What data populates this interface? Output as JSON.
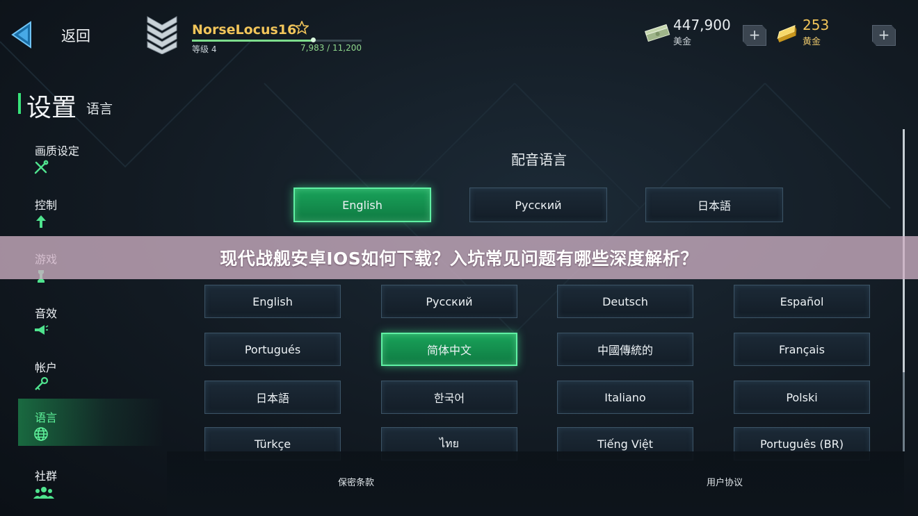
{
  "topbar": {
    "back_label": "返回",
    "player_name": "NorseLocus16",
    "level_label": "等级 4",
    "xp_text": "7,983 / 11,200",
    "xp_progress": 0.713,
    "cash": {
      "amount": "447,900",
      "label": "美金"
    },
    "gold": {
      "amount": "253",
      "label": "黄金"
    },
    "colors": {
      "gold_text": "#f2c55a",
      "xp_green": "#7ddc8c"
    }
  },
  "header": {
    "title": "设置",
    "subtitle": "语言"
  },
  "sidebar": {
    "items": [
      {
        "label": "画质设定",
        "icon": "tools-icon"
      },
      {
        "label": "控制",
        "icon": "arrow-up-icon"
      },
      {
        "label": "游戏",
        "icon": "chess-icon"
      },
      {
        "label": "音效",
        "icon": "megaphone-icon"
      },
      {
        "label": "帐户",
        "icon": "key-icon"
      },
      {
        "label": "语言",
        "icon": "globe-icon",
        "active": true
      },
      {
        "label": "社群",
        "icon": "people-icon"
      }
    ]
  },
  "voice": {
    "title": "配音语言",
    "options": [
      "English",
      "Русский",
      "日本語"
    ],
    "selected": "English"
  },
  "text_lang": {
    "options": [
      "English",
      "Русский",
      "Deutsch",
      "Español",
      "Portugués",
      "简体中文",
      "中國傳統的",
      "Français",
      "日本語",
      "한국어",
      "Italiano",
      "Polski",
      "Türkçe",
      "ไทย",
      "Tiếng Việt",
      "Português (BR)"
    ],
    "selected": "简体中文"
  },
  "footer": {
    "privacy": "保密条款",
    "terms": "用户协议"
  },
  "banner": {
    "text": "现代战舰安卓IOS如何下载？入坑常见问题有哪些深度解析？"
  },
  "accent": "#38e27a"
}
